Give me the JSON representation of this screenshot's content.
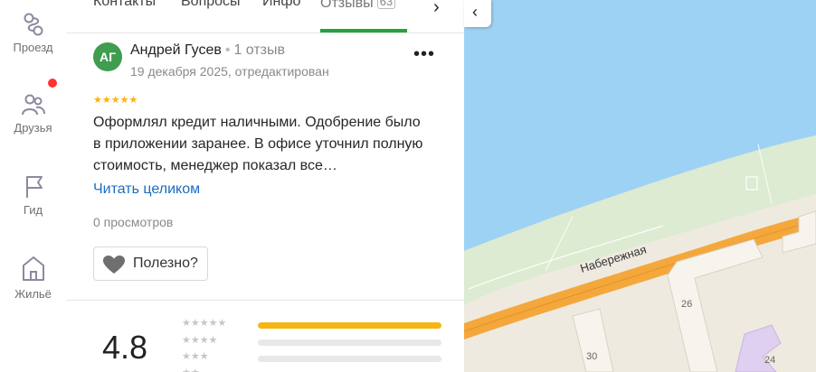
{
  "nav": {
    "items": [
      {
        "label": "Проезд",
        "icon": "route-icon"
      },
      {
        "label": "Друзья",
        "icon": "friends-icon"
      },
      {
        "label": "Гид",
        "icon": "flag-icon"
      },
      {
        "label": "Жильё",
        "icon": "house-icon"
      }
    ],
    "notification_color": "#ff3333"
  },
  "tabs": {
    "items": [
      {
        "label": "Контакты"
      },
      {
        "label": "Вопросы"
      },
      {
        "label": "Инфо"
      },
      {
        "label": "Отзывы",
        "count": "63",
        "active": true
      }
    ],
    "next_label": "›",
    "active_color": "#22a33c"
  },
  "review": {
    "avatar_initials": "АГ",
    "avatar_color": "#3f9d4f",
    "author": "Андрей Гусев",
    "separator": "•",
    "reviews_count": "1 отзыв",
    "date": "19 декабря 2025, отредактирован",
    "more_label": "•••",
    "stars": "★★★★★",
    "rating_value": 5,
    "text": "Оформлял кредит наличными. Одобрение было в приложении заранее. В офисе уточнил полную стоимость, менеджер показал все…",
    "read_more": "Читать целиком",
    "views": "0 просмотров",
    "helpful_label": "Полезно?"
  },
  "summary": {
    "rating": "4.8",
    "distribution": [
      {
        "stars": "★★★★★",
        "fraction": 1.0
      },
      {
        "stars": "★★★★",
        "fraction": 0.0
      },
      {
        "stars": "★★★",
        "fraction": 0.0
      },
      {
        "stars": "★★",
        "fraction": 0.0
      }
    ]
  },
  "map": {
    "street_label": "Набережная",
    "house_numbers": [
      "26",
      "30",
      "24"
    ],
    "collapse_label": "‹",
    "water_color": "#9ed2f4",
    "land_color": "#efeae0",
    "park_color": "#dcebd1",
    "road_color": "#f4a83c"
  }
}
